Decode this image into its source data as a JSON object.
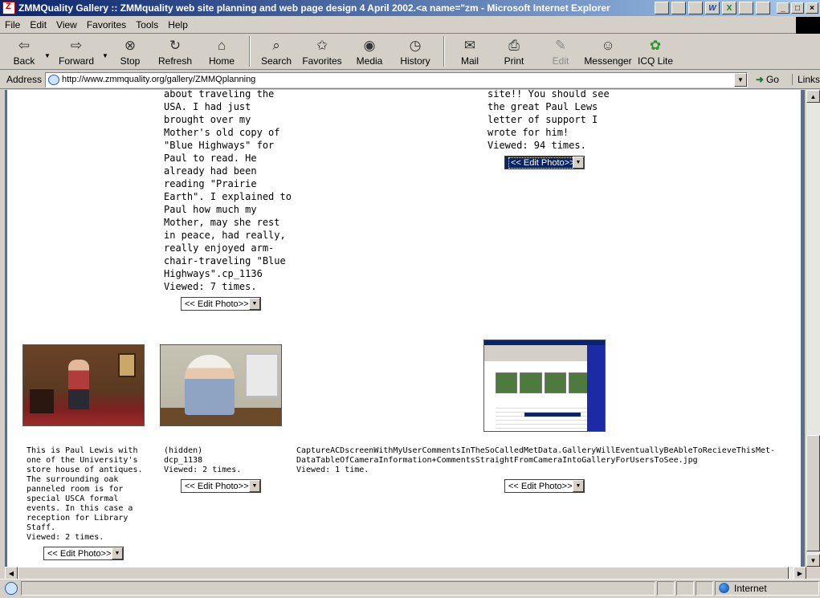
{
  "window": {
    "title": "ZMMQuality Gallery :: ZMMquality web site planning and web page design 4 April 2002.<a name=\"zm - Microsoft Internet Explorer",
    "tray_labels": [
      "",
      "",
      "",
      "W",
      "X",
      "",
      ""
    ],
    "caption_buttons": [
      "_",
      "□",
      "×"
    ]
  },
  "menu": [
    "File",
    "Edit",
    "View",
    "Favorites",
    "Tools",
    "Help"
  ],
  "toolbar": {
    "back": "Back",
    "forward": "Forward",
    "stop": "Stop",
    "refresh": "Refresh",
    "home": "Home",
    "search": "Search",
    "favorites": "Favorites",
    "media": "Media",
    "history": "History",
    "mail": "Mail",
    "print": "Print",
    "edit": "Edit",
    "messenger": "Messenger",
    "icq": "ICQ Lite"
  },
  "address": {
    "label": "Address",
    "url": "http://www.zmmquality.org/gallery/ZMMQplanning",
    "go": "Go",
    "links": "Links"
  },
  "gallery": {
    "top_left": {
      "lines": [
        "about traveling the",
        "USA. I had just",
        "brought over my",
        "Mother's old copy of",
        "\"Blue Highways\" for",
        "Paul to read. He",
        "already had been",
        "reading \"Prairie",
        "Earth\". I explained to",
        "Paul how much my",
        "Mother, may she rest",
        "in peace, had really,",
        "really enjoyed arm-",
        "chair-traveling \"Blue",
        "Highways\".cp_1136",
        "Viewed: 7 times."
      ]
    },
    "top_right": {
      "lines": [
        "site!! You should see",
        "the great Paul Lews",
        "letter of support I",
        "wrote for him!",
        "Viewed: 94 times."
      ]
    },
    "items": [
      {
        "lines": [
          "This is Paul Lewis with",
          "one of the University's",
          "store house of antiques.",
          "The surrounding oak",
          "panneled room is for",
          "special USCA formal",
          "events. In this case a",
          "reception for Library",
          "Staff.",
          "Viewed: 2 times."
        ]
      },
      {
        "lines": [
          "(hidden)",
          "dcp_1138",
          "Viewed: 2 times."
        ]
      },
      {
        "lines": [
          "CaptureACDscreenWithMyUserCommentsInTheSoCalledMetData.GalleryWillEventuallyBeAbleToRecieveThisMet-",
          "DataTableOfCameraInformation+CommentsStraightFromCameraIntoGalleryForUsersToSee.jpg",
          "Viewed: 1 time."
        ]
      }
    ],
    "edit_photo_label": "<< Edit Photo>>"
  },
  "status": {
    "zone": "Internet"
  }
}
